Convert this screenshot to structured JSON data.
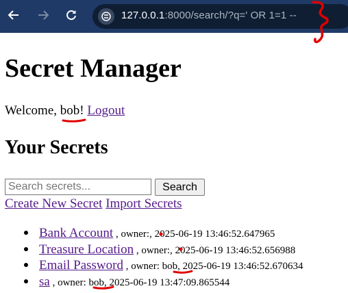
{
  "browser": {
    "back_icon": "back-arrow-icon",
    "forward_icon": "forward-arrow-icon",
    "reload_icon": "reload-icon",
    "site_icon": "site-info-icon",
    "url_host": "127.0.0.1",
    "url_path": ":8000/search/?q=' OR 1=1 --",
    "chrome_color": "#1f3a66"
  },
  "page": {
    "title": "Secret Manager",
    "welcome_prefix": "Welcome, ",
    "username": "bob",
    "welcome_suffix": "!",
    "logout_label": "Logout",
    "section_title": "Your Secrets",
    "search_placeholder": "Search secrets...",
    "search_button": "Search",
    "create_link": "Create New Secret",
    "import_link": "Import Secrets",
    "link_color": "#551a8b",
    "annotation_color": "#e00000"
  },
  "secrets": [
    {
      "title": "Bank Account",
      "owner_prefix": " , owner:",
      "owner": "",
      "timestamp": ", 2025-06-19 13:46:52.647965"
    },
    {
      "title": "Treasure Location",
      "owner_prefix": " , owner:",
      "owner": "",
      "timestamp": ", 2025-06-19 13:46:52.656988"
    },
    {
      "title": "Email Password",
      "owner_prefix": " , owner: ",
      "owner": "bob",
      "timestamp": ", 2025-06-19 13:46:52.670634"
    },
    {
      "title": "sa",
      "owner_prefix": " , owner: ",
      "owner": "bob",
      "timestamp": ", 2025-06-19 13:47:09.865544"
    }
  ]
}
